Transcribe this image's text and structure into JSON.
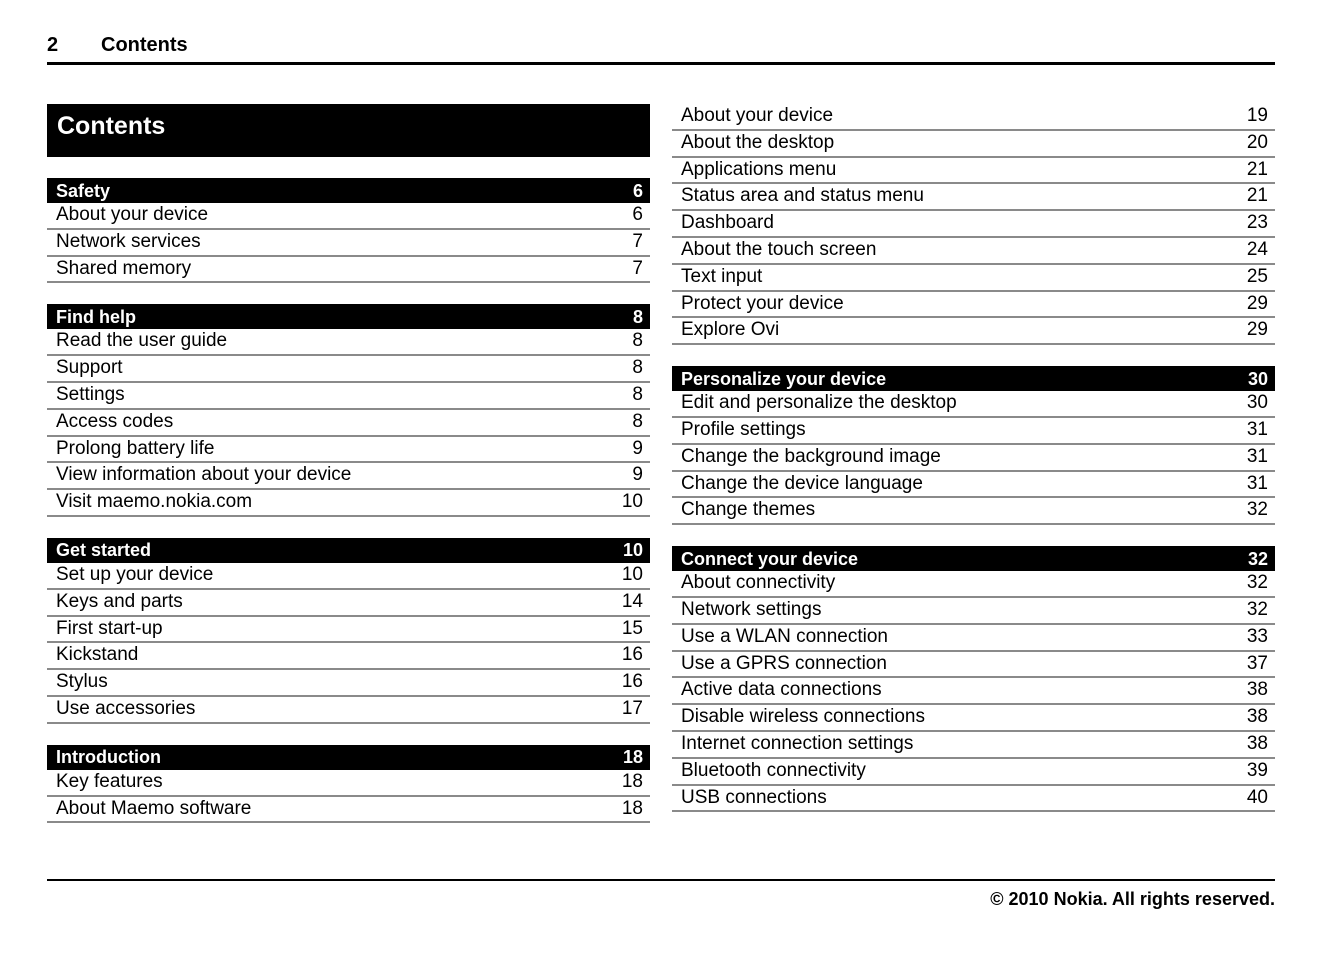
{
  "header": {
    "page_number": "2",
    "title": "Contents"
  },
  "toc_title": "Contents",
  "footer": {
    "copyright": "© 2010 Nokia. All rights reserved."
  },
  "colors": {
    "bar_background": "#000000",
    "bar_text": "#ffffff",
    "rule": "#8a8a8a",
    "page_text": "#000000"
  },
  "left_column": [
    {
      "header": {
        "label": "Safety",
        "page": "6"
      },
      "entries": [
        {
          "label": "About your device",
          "page": "6"
        },
        {
          "label": "Network services",
          "page": "7"
        },
        {
          "label": "Shared memory",
          "page": "7"
        }
      ]
    },
    {
      "header": {
        "label": "Find help",
        "page": "8"
      },
      "entries": [
        {
          "label": "Read the user guide",
          "page": "8"
        },
        {
          "label": "Support",
          "page": "8"
        },
        {
          "label": "Settings",
          "page": "8"
        },
        {
          "label": "Access codes",
          "page": "8"
        },
        {
          "label": "Prolong battery life",
          "page": "9"
        },
        {
          "label": "View information about your device",
          "page": "9"
        },
        {
          "label": "Visit maemo.nokia.com",
          "page": "10"
        }
      ]
    },
    {
      "header": {
        "label": "Get started",
        "page": "10"
      },
      "entries": [
        {
          "label": "Set up your device",
          "page": "10"
        },
        {
          "label": "Keys and parts",
          "page": "14"
        },
        {
          "label": "First start-up",
          "page": "15"
        },
        {
          "label": "Kickstand",
          "page": "16"
        },
        {
          "label": "Stylus",
          "page": "16"
        },
        {
          "label": "Use accessories",
          "page": "17"
        }
      ]
    },
    {
      "header": {
        "label": "Introduction",
        "page": "18"
      },
      "entries": [
        {
          "label": "Key features",
          "page": "18"
        },
        {
          "label": "About Maemo software",
          "page": "18"
        }
      ]
    }
  ],
  "right_column": [
    {
      "header": null,
      "entries": [
        {
          "label": "About your device",
          "page": "19"
        },
        {
          "label": "About the desktop",
          "page": "20"
        },
        {
          "label": "Applications menu",
          "page": "21"
        },
        {
          "label": "Status area and status menu",
          "page": "21"
        },
        {
          "label": "Dashboard",
          "page": "23"
        },
        {
          "label": "About the touch screen",
          "page": "24"
        },
        {
          "label": "Text input",
          "page": "25"
        },
        {
          "label": "Protect your device",
          "page": "29"
        },
        {
          "label": "Explore Ovi",
          "page": "29"
        }
      ]
    },
    {
      "header": {
        "label": "Personalize your device",
        "page": "30"
      },
      "entries": [
        {
          "label": "Edit and personalize the desktop",
          "page": "30"
        },
        {
          "label": "Profile settings",
          "page": "31"
        },
        {
          "label": "Change the background image",
          "page": "31"
        },
        {
          "label": "Change the device language",
          "page": "31"
        },
        {
          "label": "Change themes",
          "page": "32"
        }
      ]
    },
    {
      "header": {
        "label": "Connect your device",
        "page": "32"
      },
      "entries": [
        {
          "label": "About connectivity",
          "page": "32"
        },
        {
          "label": "Network settings",
          "page": "32"
        },
        {
          "label": "Use a WLAN connection",
          "page": "33"
        },
        {
          "label": "Use a GPRS connection",
          "page": "37"
        },
        {
          "label": "Active data connections",
          "page": "38"
        },
        {
          "label": "Disable wireless connections",
          "page": "38"
        },
        {
          "label": "Internet connection settings",
          "page": "38"
        },
        {
          "label": "Bluetooth connectivity",
          "page": "39"
        },
        {
          "label": "USB connections",
          "page": "40"
        }
      ]
    }
  ]
}
